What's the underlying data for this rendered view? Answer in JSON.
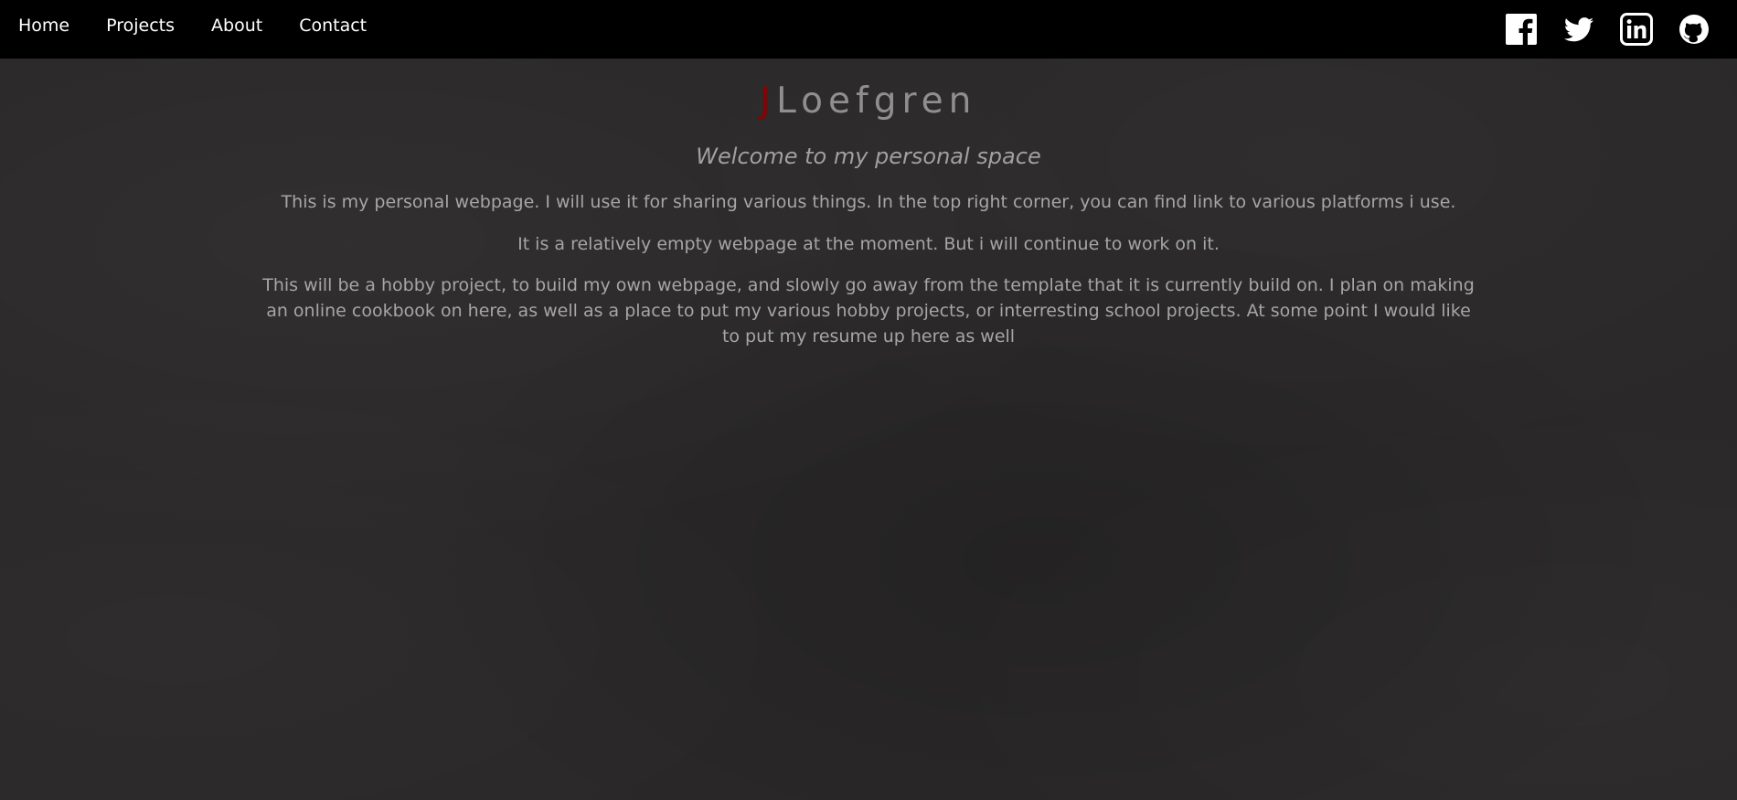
{
  "nav": {
    "items": [
      {
        "label": "Home"
      },
      {
        "label": "Projects"
      },
      {
        "label": "About"
      },
      {
        "label": "Contact"
      }
    ]
  },
  "social": {
    "icons": [
      "facebook-icon",
      "twitter-icon",
      "linkedin-icon",
      "github-icon"
    ]
  },
  "header": {
    "title_initial": "J",
    "title_rest": "Loefgren",
    "subtitle": "Welcome to my personal space"
  },
  "paragraphs": [
    "This is my personal webpage. I will use it for sharing various things. In the top right corner, you can find link to various platforms i use.",
    "It is a relatively empty webpage at the moment. But i will continue to work on it.",
    "This will be a hobby project, to build my own webpage, and slowly go away from the template that it is currently build on. I plan on making an online cookbook on here, as well as a place to put my various hobby projects, or interresting school projects. At some point I would like to put my resume up here as well"
  ],
  "colors": {
    "nav_background": "#000000",
    "page_background": "#2a2828",
    "title_initial": "#8b0000",
    "text": "#a6a6a6"
  }
}
